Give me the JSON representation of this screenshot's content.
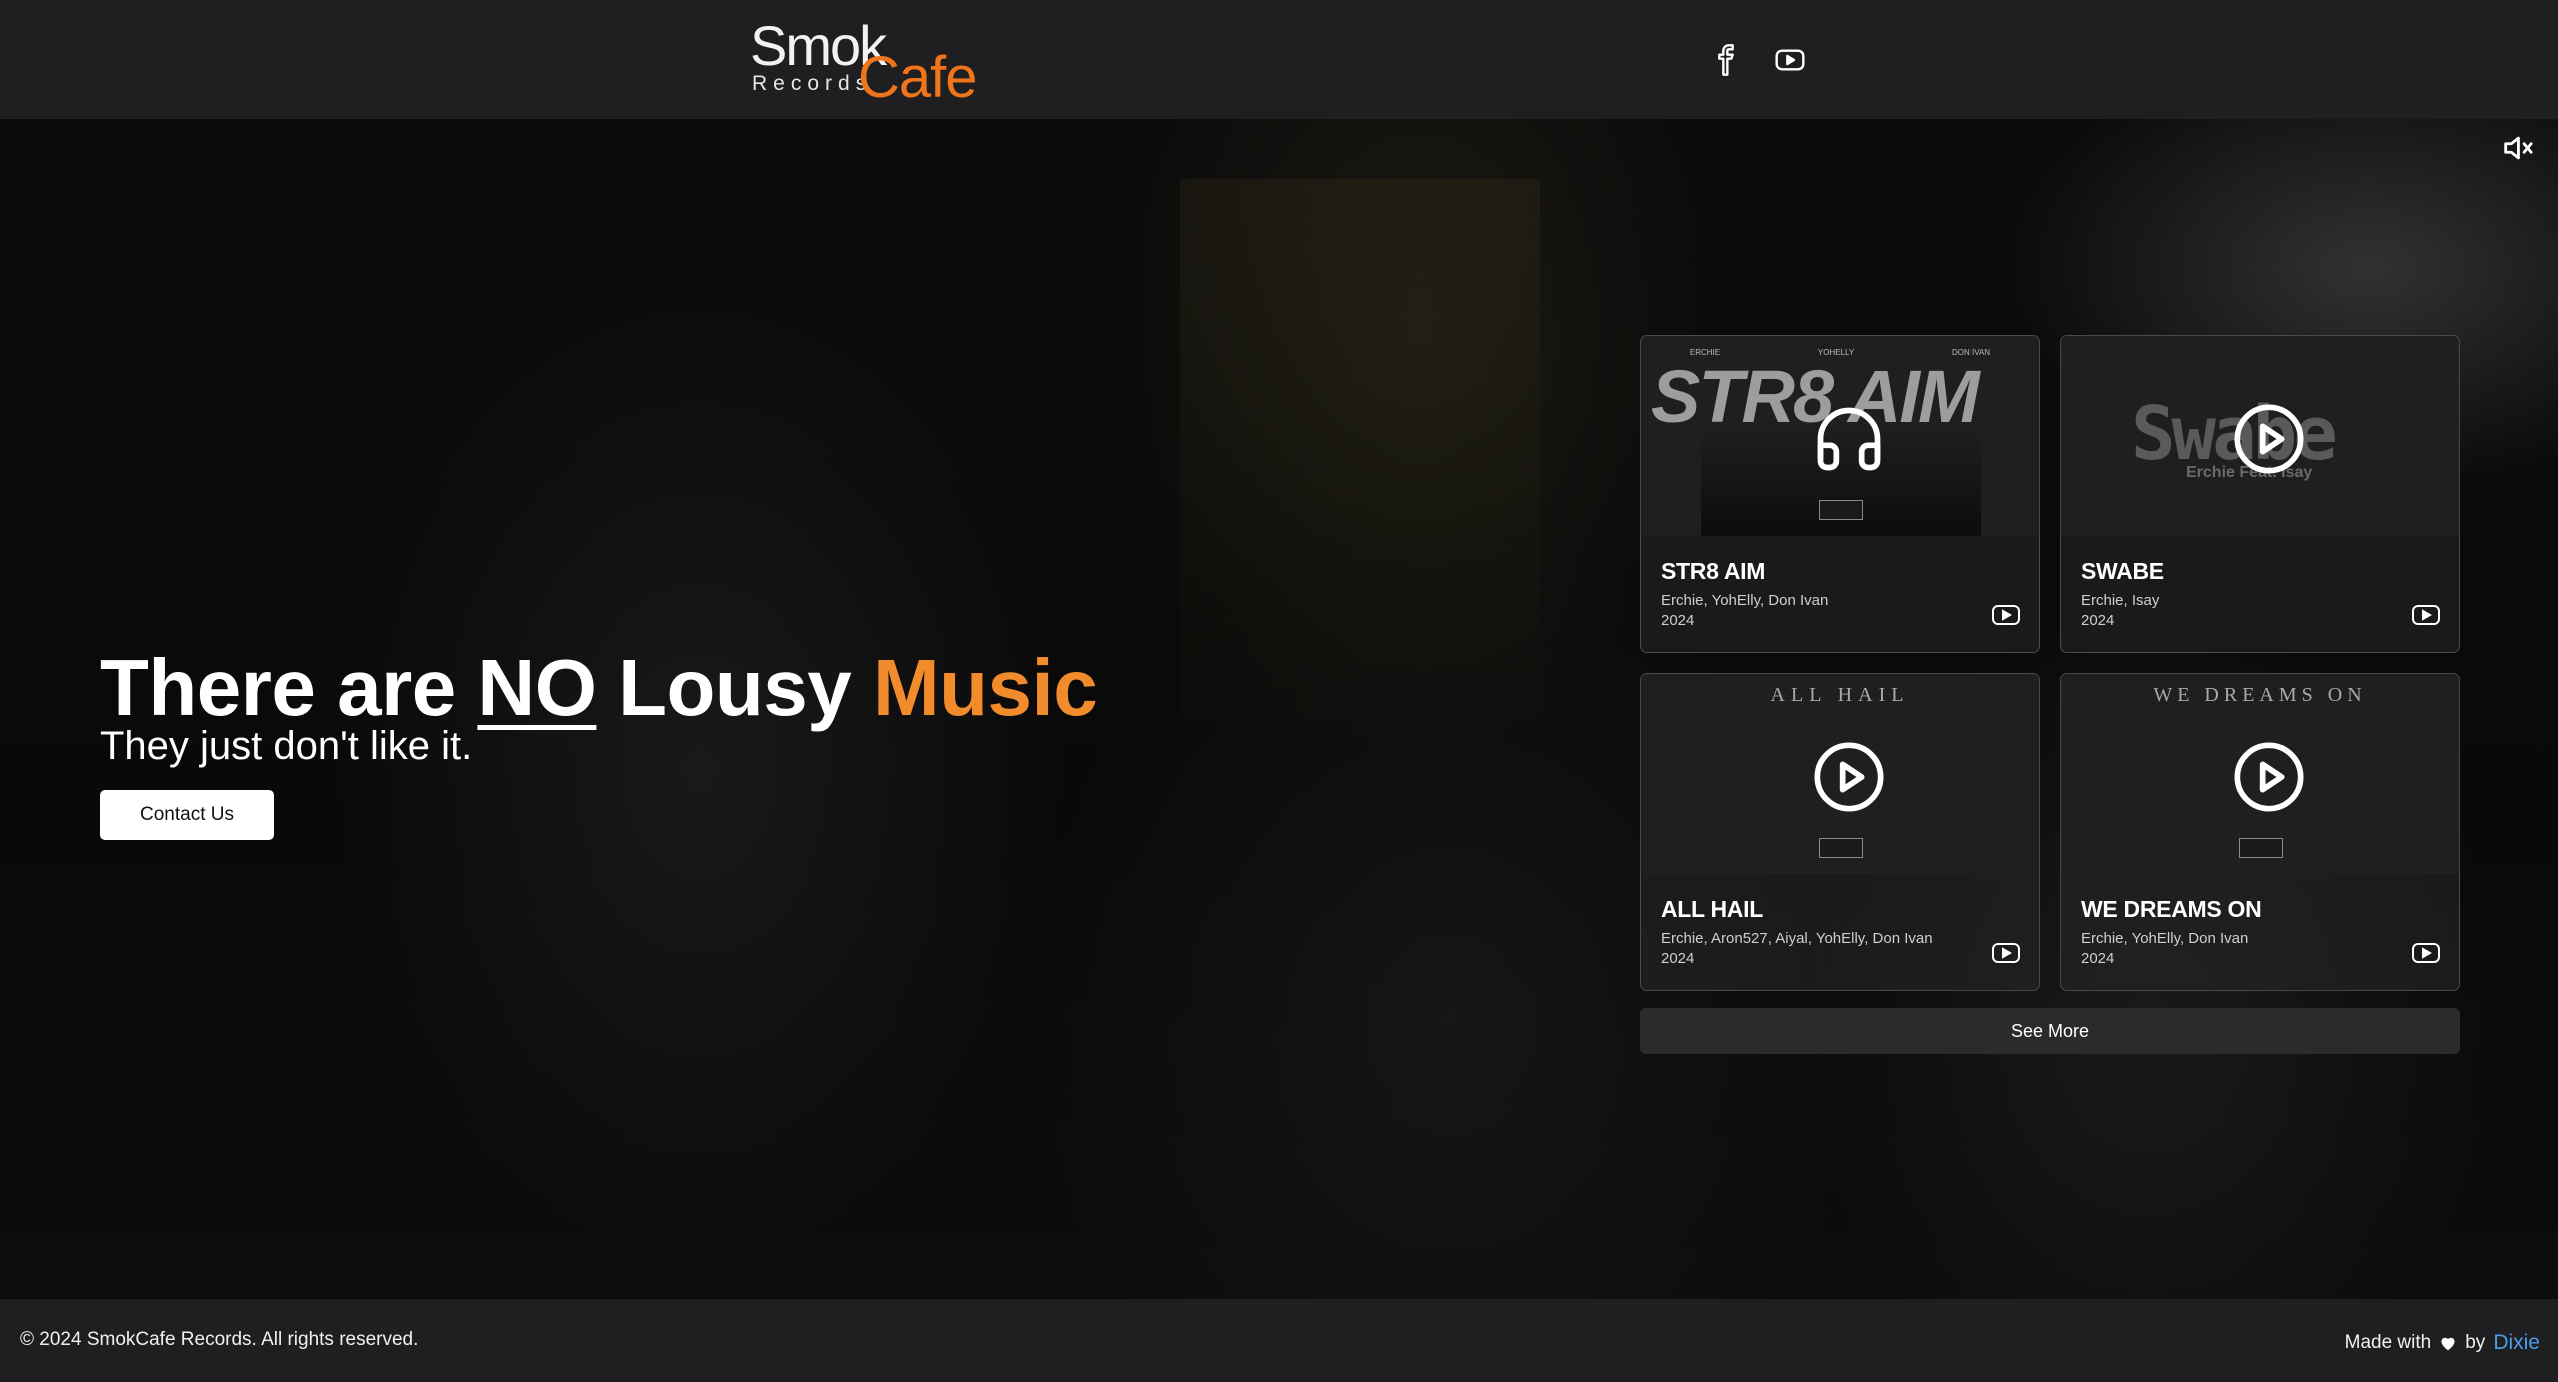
{
  "header": {
    "logo": {
      "smok": "Smok",
      "records": "Records",
      "cafe": "Cafe"
    },
    "social": [
      {
        "name": "facebook-icon"
      },
      {
        "name": "youtube-icon"
      }
    ]
  },
  "hero": {
    "headline_part1": "There are ",
    "headline_no": "NO",
    "headline_part2": " Lousy ",
    "headline_music": "Music",
    "subline": "They just don't like it.",
    "contact_label": "Contact Us",
    "mute_icon": "speaker-muted-icon"
  },
  "cards": [
    {
      "title": "STR8 AIM",
      "artists": "Erchie, YohElly, Don Ivan",
      "year": "2024",
      "cover_text": "STR8 AIM",
      "cover_names": [
        "ERCHIE",
        "YOHELLY",
        "DON IVAN"
      ],
      "icon": "headphones-icon"
    },
    {
      "title": "SWABE",
      "artists": "Erchie, Isay",
      "year": "2024",
      "cover_text": "Swabe",
      "cover_sub": "Erchie Feat. Isay",
      "icon": "play-circle-icon"
    },
    {
      "title": "ALL HAIL",
      "artists": "Erchie, Aron527, Aiyal, YohElly, Don Ivan",
      "year": "2024",
      "cover_text": "ALL HAIL",
      "icon": "play-circle-icon"
    },
    {
      "title": "WE DREAMS ON",
      "artists": "Erchie, YohElly, Don Ivan",
      "year": "2024",
      "cover_text": "WE DREAMS ON",
      "icon": "play-circle-icon"
    }
  ],
  "see_more_label": "See More",
  "footer": {
    "copyright": "© 2024 SmokCafe Records. All rights reserved.",
    "made_with": "Made with",
    "by": "by",
    "author": "Dixie"
  },
  "colors": {
    "accent": "#f28b2c",
    "link": "#4a9ee8",
    "header_bg": "#1f1f21"
  }
}
